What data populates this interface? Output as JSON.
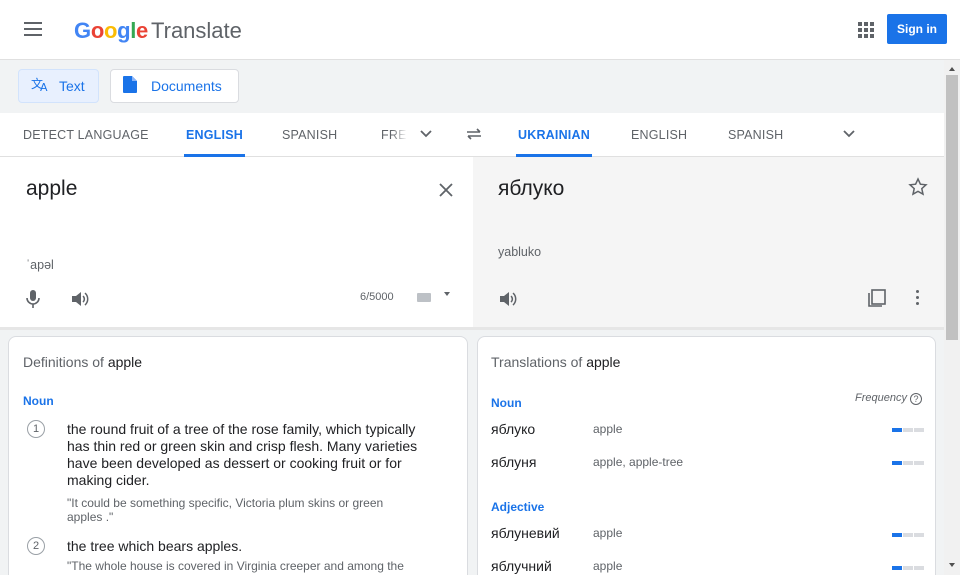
{
  "header": {
    "logo": {
      "G": "G",
      "o1": "o",
      "o2": "o",
      "g": "g",
      "l": "l",
      "e": "e"
    },
    "product": "Translate",
    "sign_in": "Sign in",
    "colors": {
      "blue": "#4285F4",
      "red": "#EA4335",
      "yellow": "#FBBC05",
      "green": "#34A853",
      "accent": "#1a73e8"
    }
  },
  "modes": [
    {
      "label": "Text",
      "icon": "translate-icon",
      "active": true
    },
    {
      "label": "Documents",
      "icon": "document-icon",
      "active": false
    }
  ],
  "source_langs": [
    "DETECT LANGUAGE",
    "ENGLISH",
    "SPANISH",
    "FRE"
  ],
  "target_langs": [
    "UKRAINIAN",
    "ENGLISH",
    "SPANISH"
  ],
  "source": {
    "text": "apple",
    "phonetic": "ˈapəl",
    "char_count": "6/5000"
  },
  "target": {
    "text": "яблуко",
    "transliteration": "yabluko"
  },
  "definitions": {
    "title_prefix": "Definitions of",
    "word": "apple",
    "pos": "Noun",
    "items": [
      {
        "num": "1",
        "lines": [
          "the round fruit of a tree of the rose family, which typically",
          "has thin red or green skin and crisp flesh. Many varieties",
          "have been developed as dessert or cooking fruit or for",
          "making cider."
        ],
        "example_lines": [
          "\"It could be something specific, Victoria plum skins or green",
          "apples .\""
        ]
      },
      {
        "num": "2",
        "lines": [
          "the tree which bears apples."
        ],
        "example_lines": [
          "\"The whole house is covered in Virginia creeper and among the"
        ]
      }
    ]
  },
  "translations": {
    "title_prefix": "Translations of",
    "word": "apple",
    "frequency_label": "Frequency",
    "help": "?",
    "groups": [
      {
        "pos": "Noun",
        "rows": [
          {
            "word": "яблуко",
            "back": "apple",
            "frequency": 0.33
          },
          {
            "word": "яблуня",
            "back": "apple, apple-tree",
            "frequency": 0.33
          }
        ]
      },
      {
        "pos": "Adjective",
        "rows": [
          {
            "word": "яблуневий",
            "back": "apple",
            "frequency": 0.33
          },
          {
            "word": "яблучний",
            "back": "apple",
            "frequency": 0.33
          }
        ]
      }
    ]
  }
}
